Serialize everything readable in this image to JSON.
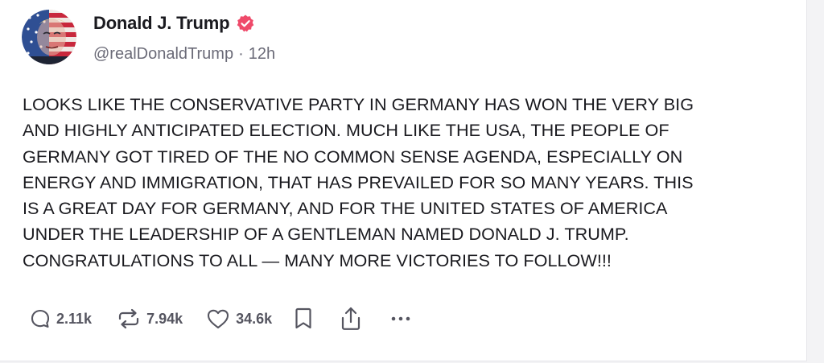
{
  "post": {
    "author": {
      "display_name": "Donald J. Trump",
      "handle": "@realDonaldTrump",
      "separator": "·",
      "time": "12h",
      "verified_badge_color": "#ef4a6a"
    },
    "body": "LOOKS LIKE THE CONSERVATIVE PARTY  IN GERMANY HAS WON THE VERY BIG\nAND HIGHLY ANTICIPATED ELECTION. MUCH LIKE THE USA, THE PEOPLE OF\nGERMANY GOT TIRED OF THE NO COMMON SENSE AGENDA, ESPECIALLY ON\nENERGY AND IMMIGRATION, THAT HAS PREVAILED FOR SO MANY YEARS. THIS\nIS A GREAT DAY FOR GERMANY, AND FOR THE UNITED STATES OF AMERICA\nUNDER THE LEADERSHIP OF A GENTLEMAN NAMED DONALD J. TRUMP.\nCONGRATULATIONS TO ALL — MANY MORE VICTORIES TO FOLLOW!!!",
    "actions": {
      "replies": {
        "icon": "reply-icon",
        "count": "2.11k"
      },
      "restruths": {
        "icon": "restruth-icon",
        "count": "7.94k"
      },
      "likes": {
        "icon": "heart-icon",
        "count": "34.6k"
      },
      "bookmark": {
        "icon": "bookmark-icon"
      },
      "share": {
        "icon": "share-icon"
      },
      "more": {
        "icon": "more-icon"
      }
    }
  },
  "colors": {
    "text": "#1a1a1f",
    "muted": "#6b6b78",
    "icon": "#555560",
    "verified": "#ef4a6a"
  }
}
